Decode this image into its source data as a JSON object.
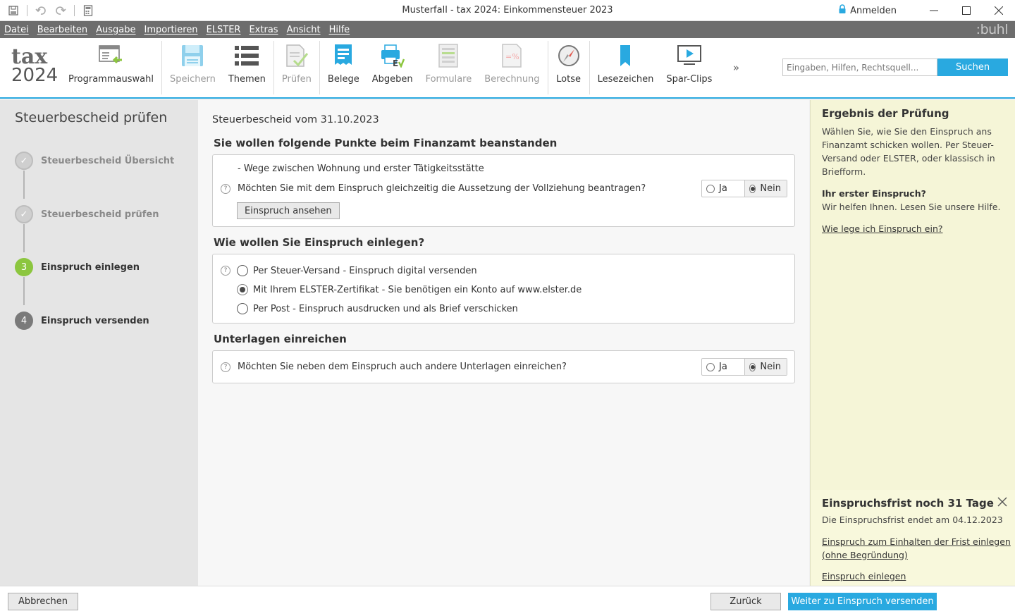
{
  "window": {
    "title": "Musterfall - tax 2024: Einkommensteuer 2023",
    "login_label": "Anmelden"
  },
  "menu": {
    "items": [
      "Datei",
      "Bearbeiten",
      "Ausgabe",
      "Importieren",
      "ELSTER",
      "Extras",
      "Ansicht",
      "Hilfe"
    ],
    "brand": ":buhl"
  },
  "logo": {
    "line1": "tax",
    "line2": "2024"
  },
  "toolbar": {
    "programmauswahl": "Programmauswahl",
    "speichern": "Speichern",
    "themen": "Themen",
    "pruefen": "Prüfen",
    "belege": "Belege",
    "abgeben": "Abgeben",
    "formulare": "Formulare",
    "berechnung": "Berechnung",
    "lotse": "Lotse",
    "lesezeichen": "Lesezeichen",
    "spar_clips": "Spar-Clips",
    "more": "»"
  },
  "search": {
    "placeholder": "Eingaben, Hilfen, Rechtsquell...",
    "button": "Suchen"
  },
  "steps": {
    "title": "Steuerbescheid prüfen",
    "items": [
      {
        "label": "Steuerbescheid Übersicht",
        "marker": "✓"
      },
      {
        "label": "Steuerbescheid prüfen",
        "marker": "✓"
      },
      {
        "label": "Einspruch einlegen",
        "marker": "3"
      },
      {
        "label": "Einspruch versenden",
        "marker": "4"
      }
    ]
  },
  "main": {
    "date_title": "Steuerbescheid vom 31.10.2023",
    "section1": {
      "title": "Sie wollen folgende Punkte beim Finanzamt beanstanden",
      "item": "- Wege zwischen Wohnung und erster Tätigkeitsstätte",
      "question": "Möchten Sie mit dem Einspruch gleichzeitig die Aussetzung der Vollziehung beantragen?",
      "yes": "Ja",
      "no": "Nein",
      "button": "Einspruch ansehen"
    },
    "section2": {
      "title": "Wie wollen Sie Einspruch einlegen?",
      "options": [
        "Per Steuer-Versand - Einspruch digital versenden",
        "Mit Ihrem ELSTER-Zertifikat - Sie benötigen ein Konto auf www.elster.de",
        "Per Post - Einspruch ausdrucken und als Brief verschicken"
      ],
      "selected": 1
    },
    "section3": {
      "title": "Unterlagen einreichen",
      "question": "Möchten Sie neben dem Einspruch auch andere Unterlagen einreichen?",
      "yes": "Ja",
      "no": "Nein"
    },
    "help_symbol": "?"
  },
  "right": {
    "title": "Ergebnis der Prüfung",
    "text": "Wählen Sie, wie Sie den Einspruch ans Finanzamt schicken wollen. Per Steuer-Versand oder ELSTER, oder klassisch in Briefform.",
    "first_title": "Ihr erster Einspruch?",
    "first_text": "Wir helfen Ihnen. Lesen Sie unsere Hilfe.",
    "link1": "Wie lege ich Einspruch ein?",
    "deadline_title": "Einspruchsfrist noch 31 Tage",
    "deadline_text": "Die Einspruchsfrist endet am 04.12.2023",
    "link2": "Einspruch zum Einhalten der Frist einlegen (ohne Begründung)",
    "link3": "Einspruch einlegen"
  },
  "footer": {
    "cancel": "Abbrechen",
    "back": "Zurück",
    "next": "Weiter zu Einspruch versenden"
  },
  "colors": {
    "accent": "#29a9e0",
    "step_active": "#8cc63f",
    "help_bg": "#f5f5d7"
  }
}
